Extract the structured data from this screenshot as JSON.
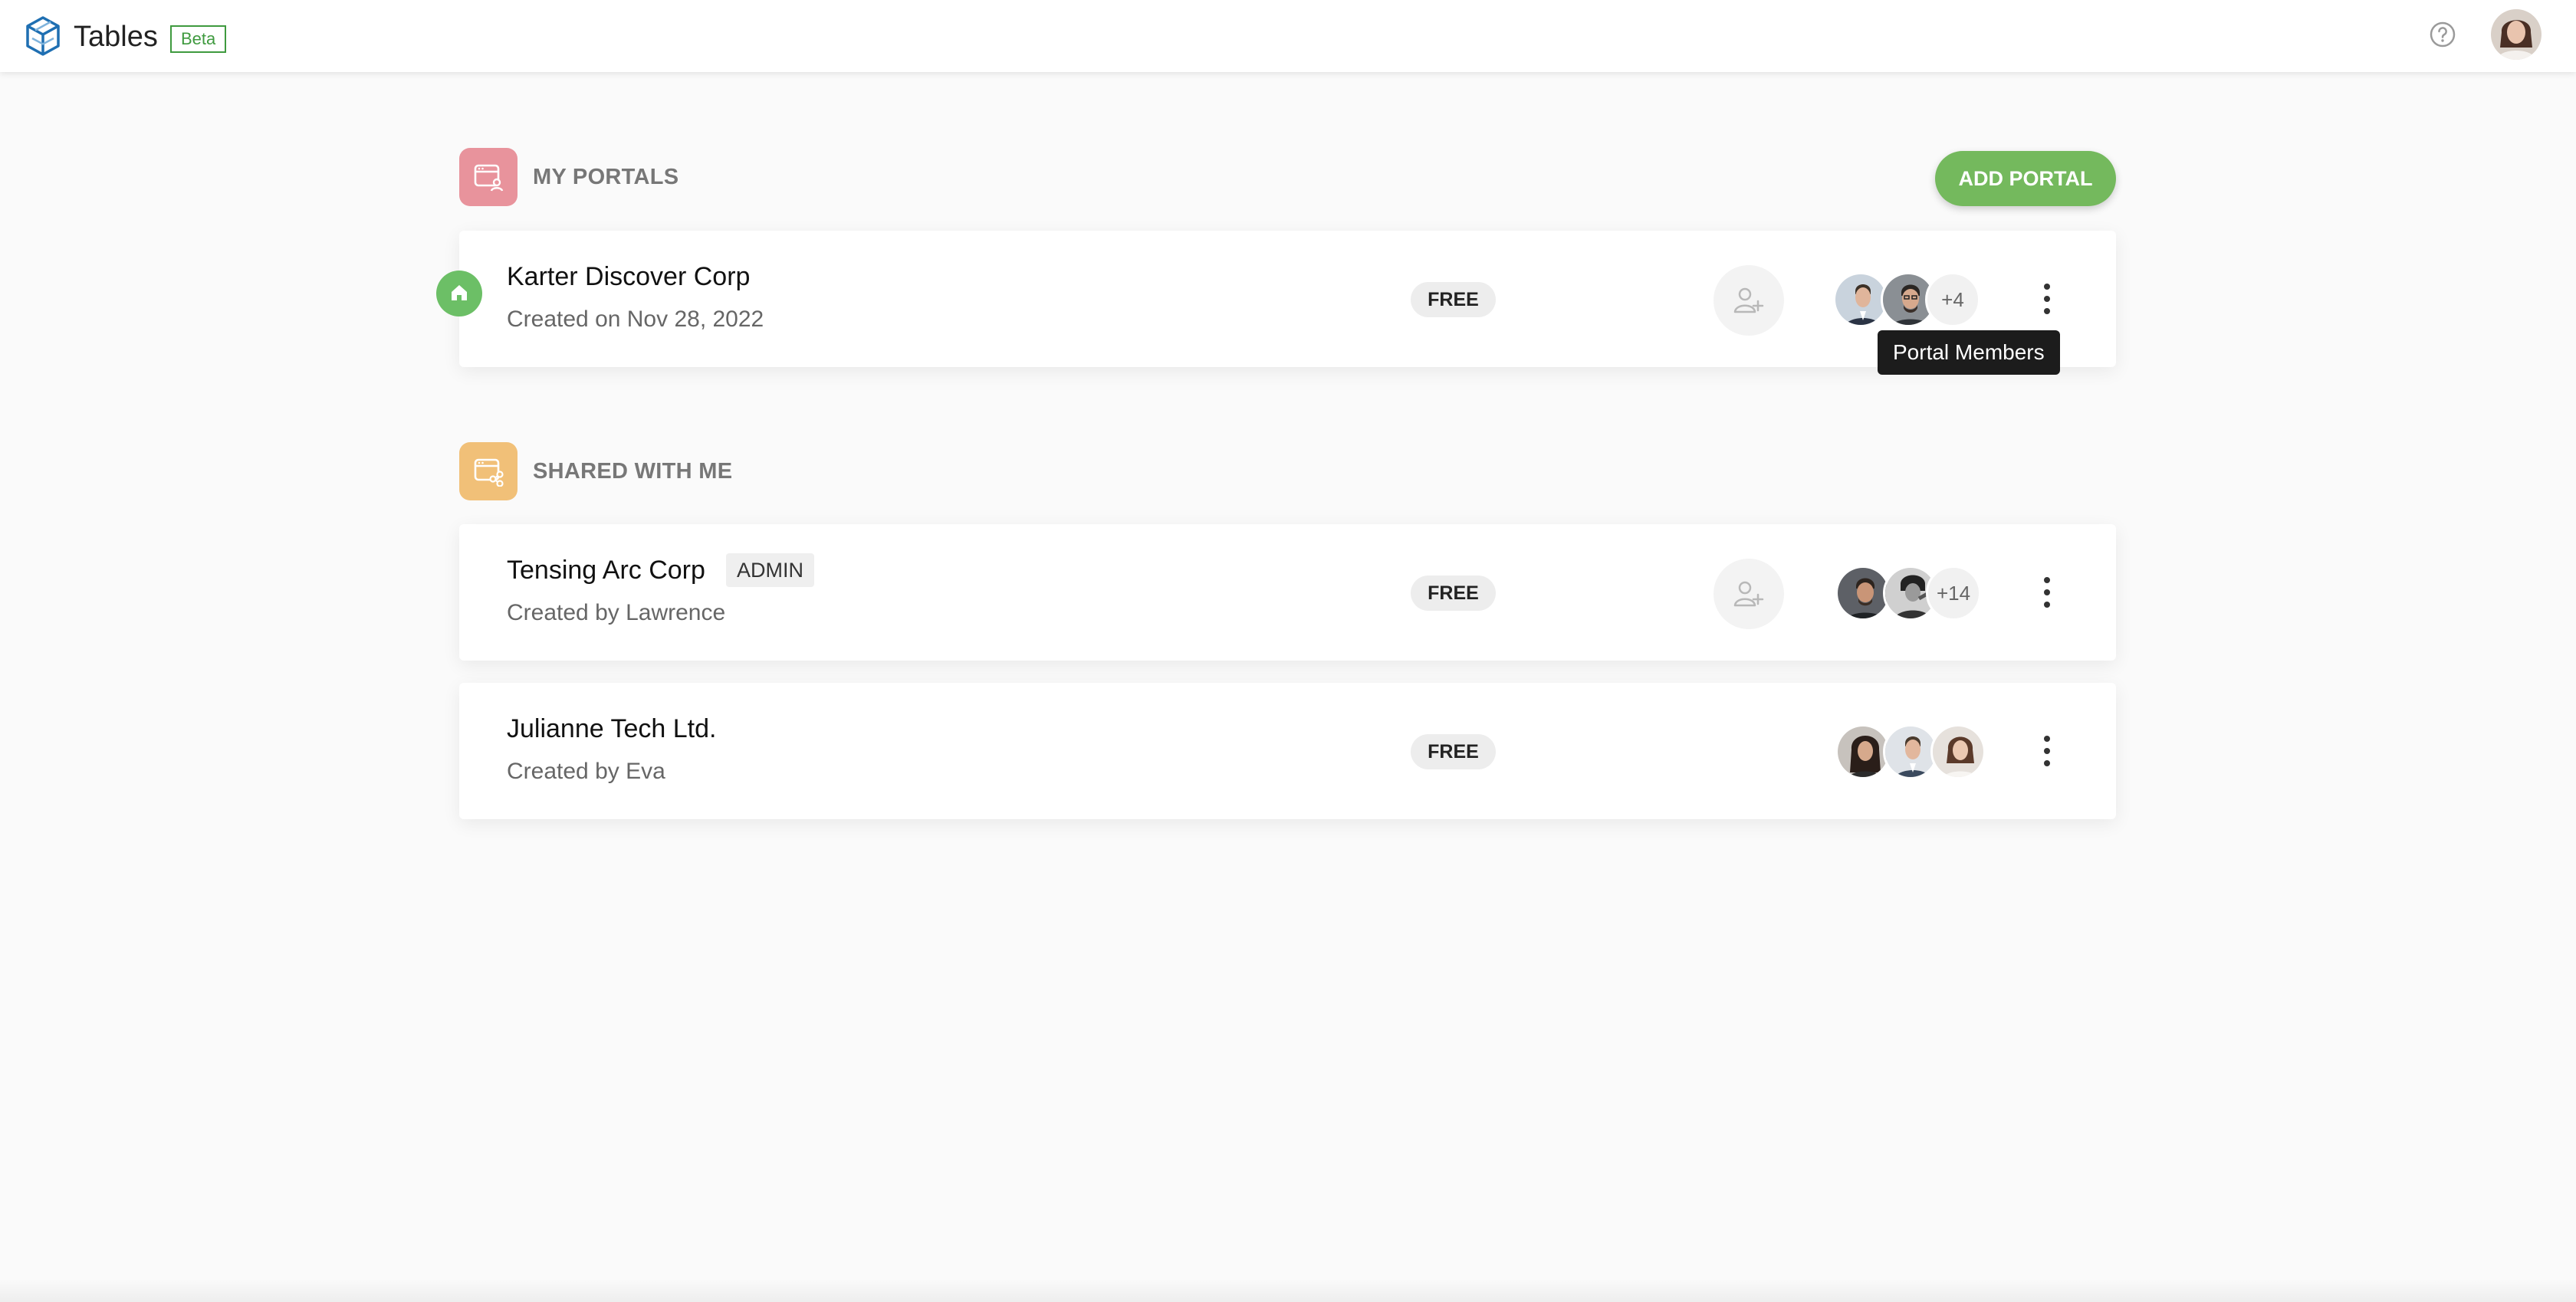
{
  "header": {
    "app_title": "Tables",
    "beta_label": "Beta",
    "icons": [
      "tables-logo-icon",
      "help-icon",
      "user-avatar"
    ]
  },
  "my_portals": {
    "title": "MY PORTALS",
    "add_button": "ADD PORTAL",
    "portals": [
      {
        "name": "Karter Discover Corp",
        "subtitle": "Created on Nov 28, 2022",
        "plan": "FREE",
        "member_overflow": "+4",
        "is_home": true
      }
    ]
  },
  "shared_with_me": {
    "title": "SHARED WITH ME",
    "portals": [
      {
        "name": "Tensing Arc Corp",
        "role": "ADMIN",
        "subtitle": "Created by Lawrence",
        "plan": "FREE",
        "member_overflow": "+14"
      },
      {
        "name": "Julianne Tech Ltd.",
        "subtitle": "Created by Eva",
        "plan": "FREE"
      }
    ]
  },
  "tooltip": "Portal Members",
  "colors": {
    "accent_green": "#74b95d",
    "my_portals_icon_bg": "#e8939c",
    "shared_icon_bg": "#f1c078",
    "beta_green": "#3f9a3f"
  }
}
